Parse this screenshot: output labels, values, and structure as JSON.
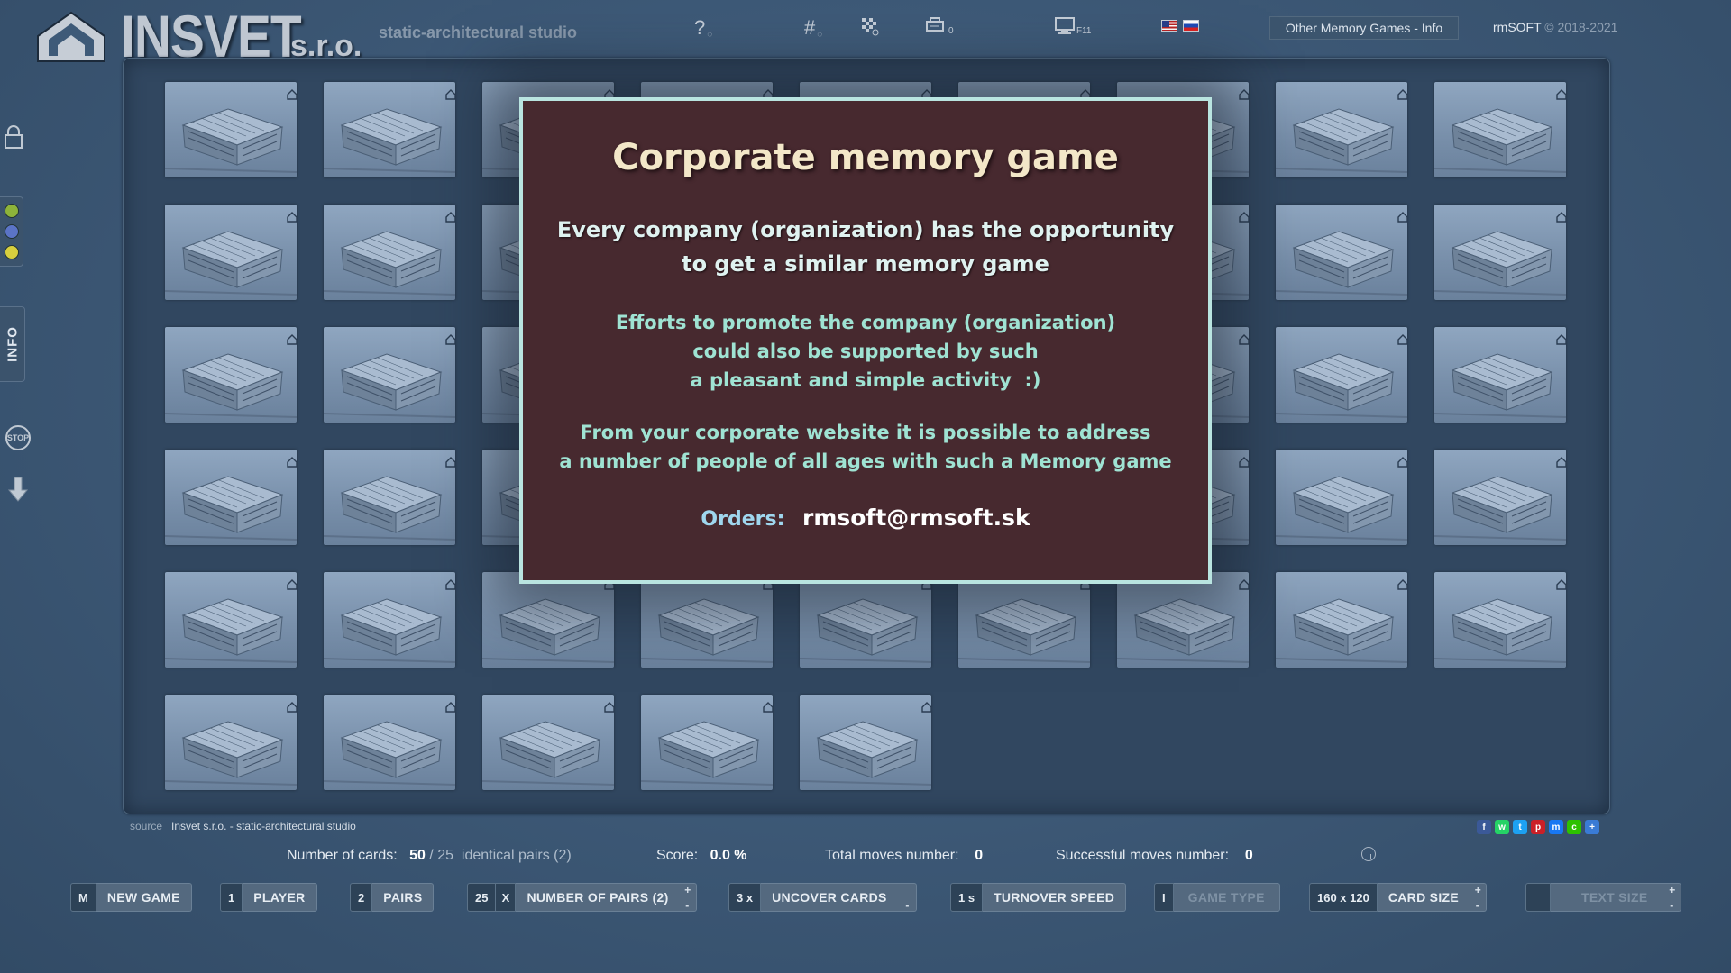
{
  "header": {
    "logo_name": "INSVET",
    "logo_suffix": "s.r.o.",
    "tagline": "static-architectural studio",
    "icons": [
      {
        "name": "help-icon",
        "glyph": "?"
      },
      {
        "name": "grid-number-icon",
        "glyph": "#"
      },
      {
        "name": "pattern-icon",
        "glyph": "▦"
      },
      {
        "name": "printer-icon",
        "glyph": "▤",
        "badge": "0"
      },
      {
        "name": "fullscreen-icon",
        "glyph": "▭",
        "badge": "F11"
      }
    ],
    "other_games": "Other Memory Games - Info",
    "copyright_brand": "rmSOFT",
    "copyright_years": "© 2018-2021"
  },
  "sidebar": {
    "info_label": "INFO",
    "stop_label": "STOP",
    "dots": [
      "#8db33a",
      "#5b74c6",
      "#d7cf3e"
    ]
  },
  "modal": {
    "title": "Corporate memory game",
    "lead": [
      "Every company (organization) has the opportunity",
      "to get a similar memory game"
    ],
    "paragraph1": [
      "Efforts to promote the company (organization)",
      "could also be supported by such",
      "a pleasant and simple activity  :)"
    ],
    "paragraph2": [
      "From your corporate website it is possible to address",
      "a number of people of all ages with such a Memory game"
    ],
    "orders_label": "Orders:",
    "orders_email": "rmsoft@rmsoft.sk"
  },
  "source": {
    "label": "source",
    "value": "Insvet s.r.o. - static-architectural studio"
  },
  "social": [
    {
      "name": "facebook-icon",
      "color": "#3b5998",
      "glyph": "f"
    },
    {
      "name": "whatsapp-icon",
      "color": "#25d366",
      "glyph": "w"
    },
    {
      "name": "twitter-icon",
      "color": "#1da1f2",
      "glyph": "t"
    },
    {
      "name": "pinterest-icon",
      "color": "#cb2027",
      "glyph": "p"
    },
    {
      "name": "messenger-icon",
      "color": "#1877f2",
      "glyph": "m"
    },
    {
      "name": "wechat-icon",
      "color": "#2dc100",
      "glyph": "c"
    },
    {
      "name": "share-plus-icon",
      "color": "#3a7bd5",
      "glyph": "+"
    }
  ],
  "status": {
    "cards_label": "Number of cards:",
    "cards_value": "50",
    "cards_sep": " / 25",
    "pairs_text": "identical pairs (2)",
    "score_label": "Score:",
    "score_value": "0.0 %",
    "moves_label": "Total moves number:",
    "moves_value": "0",
    "success_label": "Successful moves number:",
    "success_value": "0"
  },
  "toolbar": [
    {
      "name": "new-game",
      "key": "M",
      "label": "NEW GAME",
      "enabled": true
    },
    {
      "name": "player",
      "key": "1",
      "label": "PLAYER",
      "enabled": true
    },
    {
      "name": "pairs",
      "key": "2",
      "label": "PAIRS",
      "enabled": true
    },
    {
      "name": "number-of-pairs",
      "key": "25",
      "mult": "X",
      "label": "NUMBER OF PAIRS (2)",
      "enabled": true,
      "plusminus": true
    },
    {
      "name": "uncover-cards",
      "key": "3 x",
      "label": "UNCOVER CARDS",
      "enabled": true,
      "minus": true
    },
    {
      "name": "turnover-speed",
      "key": "1 s",
      "label": "TURNOVER SPEED",
      "enabled": true
    },
    {
      "name": "game-type",
      "key": "I",
      "label": "GAME TYPE",
      "enabled": false
    },
    {
      "name": "card-size",
      "key": "160 x 120",
      "label": "CARD SIZE",
      "enabled": true,
      "plusminus": true
    },
    {
      "name": "text-size",
      "key": "",
      "label": "TEXT SIZE",
      "enabled": false,
      "plusminus": true
    }
  ],
  "board": {
    "rows": [
      9,
      9,
      9,
      9,
      9,
      5
    ],
    "card_count": 50
  }
}
